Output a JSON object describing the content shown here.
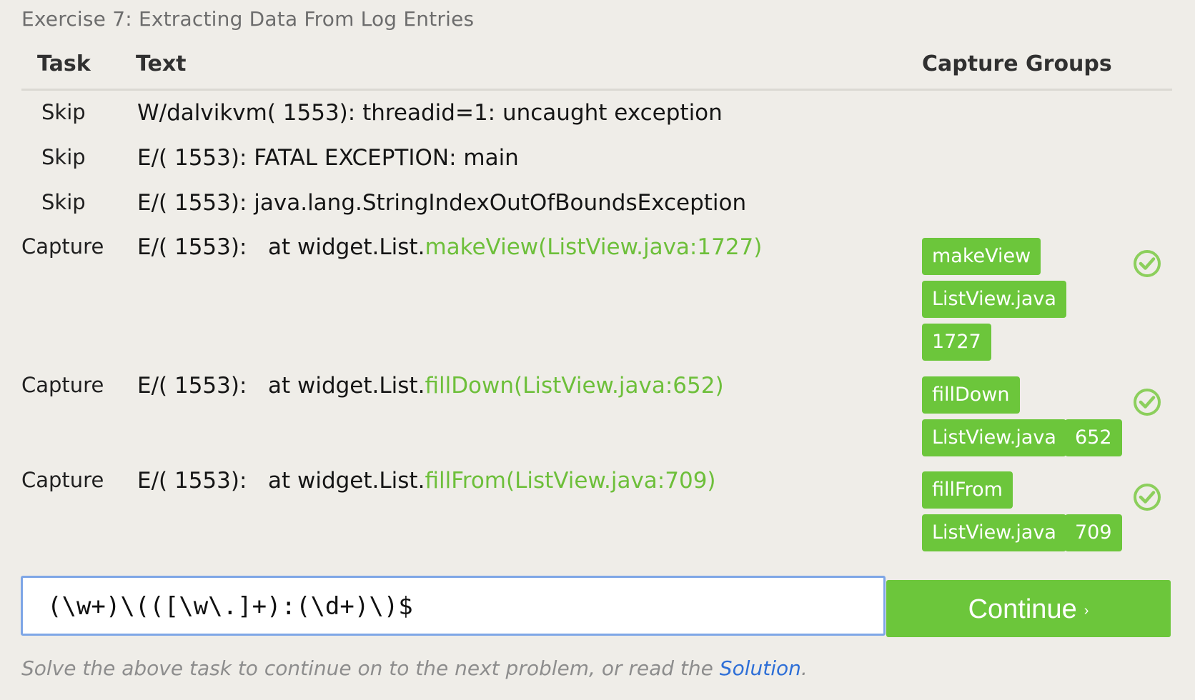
{
  "exercise": {
    "title": "Exercise 7: Extracting Data From Log Entries"
  },
  "table": {
    "headers": {
      "task": "Task",
      "text": "Text",
      "capture_groups": "Capture Groups"
    },
    "rows": [
      {
        "task": "Skip",
        "text_prefix": "W/dalvikvm( 1553): threadid=1: uncaught exception",
        "text_match": "",
        "captures": [],
        "checked": false
      },
      {
        "task": "Skip",
        "text_prefix": "E/( 1553): FATAL EXCEPTION: main",
        "text_match": "",
        "captures": [],
        "checked": false
      },
      {
        "task": "Skip",
        "text_prefix": "E/( 1553): java.lang.StringIndexOutOfBoundsException",
        "text_match": "",
        "captures": [],
        "checked": false
      },
      {
        "task": "Capture",
        "text_prefix": "E/( 1553):   at widget.List.",
        "text_match": "makeView(ListView.java:1727)",
        "captures": [
          "makeView",
          "ListView.java",
          "1727"
        ],
        "checked": true
      },
      {
        "task": "Capture",
        "text_prefix": "E/( 1553):   at widget.List.",
        "text_match": "fillDown(ListView.java:652)",
        "captures": [
          "fillDown",
          "ListView.java",
          "652"
        ],
        "checked": true
      },
      {
        "task": "Capture",
        "text_prefix": "E/( 1553):   at widget.List.",
        "text_match": "fillFrom(ListView.java:709)",
        "captures": [
          "fillFrom",
          "ListView.java",
          "709"
        ],
        "checked": true
      }
    ]
  },
  "regex_input": {
    "value": "(\\w+)\\(([\\w\\.]+):(\\d+)\\)$"
  },
  "continue_button": {
    "label": "Continue",
    "chevron": "›"
  },
  "footer": {
    "before_link": "Solve the above task to continue on to the next problem, or read the ",
    "link_text": "Solution",
    "after_link": "."
  },
  "colors": {
    "background": "#efede8",
    "accent_green": "#6cc63b",
    "match_green": "#6dbf3a",
    "input_border": "#7ea6e6",
    "link_blue": "#2e6fd7"
  },
  "icons": {
    "check": "check-circle-icon"
  }
}
